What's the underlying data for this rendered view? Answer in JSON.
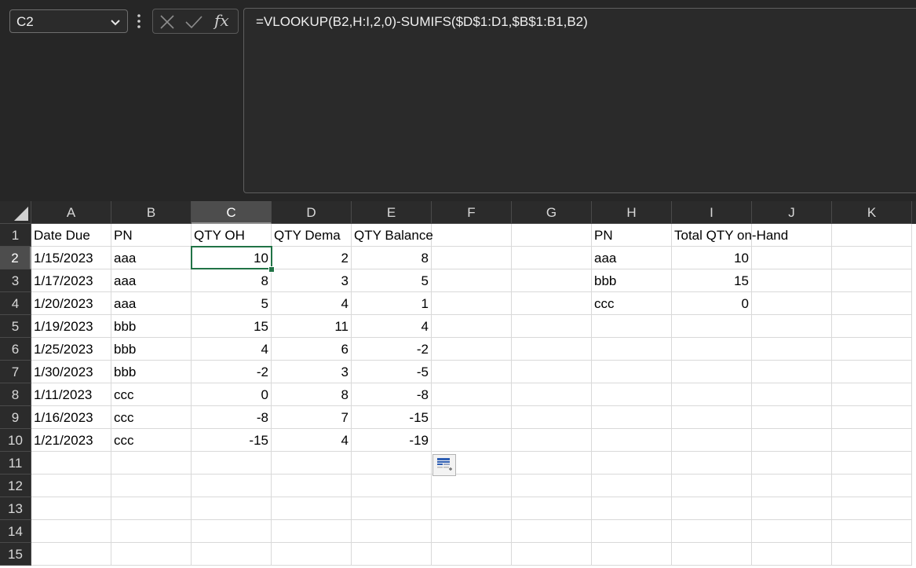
{
  "name_box": {
    "value": "C2"
  },
  "formula_bar": {
    "fx_label": "fx",
    "formula": "=VLOOKUP(B2,H:I,2,0)-SUMIFS($D$1:D1,$B$1:B1,B2)"
  },
  "columns": [
    "A",
    "B",
    "C",
    "D",
    "E",
    "F",
    "G",
    "H",
    "I",
    "J",
    "K"
  ],
  "active_column": "C",
  "rows": [
    "1",
    "2",
    "3",
    "4",
    "5",
    "6",
    "7",
    "8",
    "9",
    "10",
    "11",
    "12",
    "13",
    "14",
    "15"
  ],
  "active_row": "2",
  "headers": {
    "A": "Date Due",
    "B": "PN",
    "C": "QTY OH",
    "D": "QTY Dema",
    "E": "QTY Balance",
    "H": "PN",
    "I": "Total QTY on-Hand"
  },
  "table": [
    {
      "date": "1/15/2023",
      "pn": "aaa",
      "oh": "10",
      "demand": "2",
      "balance": "8"
    },
    {
      "date": "1/17/2023",
      "pn": "aaa",
      "oh": "8",
      "demand": "3",
      "balance": "5"
    },
    {
      "date": "1/20/2023",
      "pn": "aaa",
      "oh": "5",
      "demand": "4",
      "balance": "1"
    },
    {
      "date": "1/19/2023",
      "pn": "bbb",
      "oh": "15",
      "demand": "11",
      "balance": "4"
    },
    {
      "date": "1/25/2023",
      "pn": "bbb",
      "oh": "4",
      "demand": "6",
      "balance": "-2"
    },
    {
      "date": "1/30/2023",
      "pn": "bbb",
      "oh": "-2",
      "demand": "3",
      "balance": "-5"
    },
    {
      "date": "1/11/2023",
      "pn": "ccc",
      "oh": "0",
      "demand": "8",
      "balance": "-8"
    },
    {
      "date": "1/16/2023",
      "pn": "ccc",
      "oh": "-8",
      "demand": "7",
      "balance": "-15"
    },
    {
      "date": "1/21/2023",
      "pn": "ccc",
      "oh": "-15",
      "demand": "4",
      "balance": "-19"
    }
  ],
  "lookup": [
    {
      "pn": "aaa",
      "total": "10"
    },
    {
      "pn": "bbb",
      "total": "15"
    },
    {
      "pn": "ccc",
      "total": "0"
    }
  ],
  "icons": {
    "name_box_dropdown": "chevron-down-icon",
    "more": "vertical-dots-icon",
    "cancel": "x-icon",
    "enter": "checkmark-icon",
    "quick_analysis": "quick-analysis-icon"
  },
  "colors": {
    "selection": "#217346",
    "chrome": "#262626",
    "header_bg": "#2b2b2b",
    "gridline": "#d9d9d9"
  }
}
